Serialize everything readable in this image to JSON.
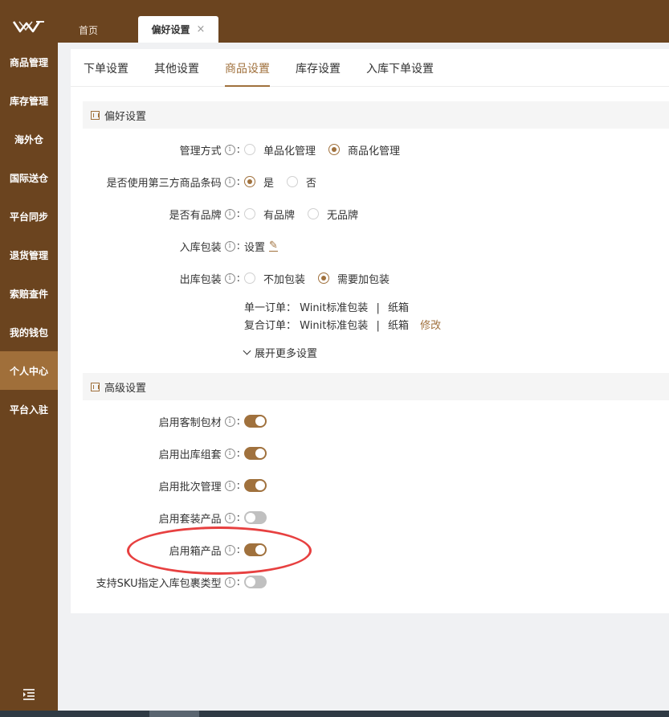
{
  "sidebar": {
    "items": [
      {
        "label": "商品管理"
      },
      {
        "label": "库存管理"
      },
      {
        "label": "海外仓"
      },
      {
        "label": "国际送仓"
      },
      {
        "label": "平台同步"
      },
      {
        "label": "退货管理"
      },
      {
        "label": "索赔查件"
      },
      {
        "label": "我的钱包"
      },
      {
        "label": "个人中心",
        "active": true
      },
      {
        "label": "平台入驻"
      }
    ],
    "bottom_icon": "menu-indent-icon"
  },
  "topbar": {
    "tabs": [
      {
        "label": "首页"
      },
      {
        "label": "偏好设置",
        "close": "×",
        "active": true
      }
    ]
  },
  "subtabs": [
    {
      "label": "下单设置"
    },
    {
      "label": "其他设置"
    },
    {
      "label": "商品设置",
      "active": true
    },
    {
      "label": "库存设置"
    },
    {
      "label": "入库下单设置"
    }
  ],
  "preference": {
    "title": "偏好设置",
    "manage_mode": {
      "label": "管理方式",
      "options": [
        "单品化管理",
        "商品化管理"
      ],
      "selected": 1
    },
    "third_party_barcode": {
      "label": "是否使用第三方商品条码",
      "options": [
        "是",
        "否"
      ],
      "selected": 0
    },
    "has_brand": {
      "label": "是否有品牌",
      "options": [
        "有品牌",
        "无品牌"
      ],
      "selected": -1
    },
    "inbound_packing": {
      "label": "入库包装",
      "value": "设置"
    },
    "outbound_packing": {
      "label": "出库包装",
      "options": [
        "不加包装",
        "需要加包装"
      ],
      "selected": 1
    },
    "packing_lines": [
      {
        "key": "单一订单：",
        "pack": "Winit标准包装",
        "sep": "|",
        "box": "纸箱"
      },
      {
        "key": "复合订单：",
        "pack": "Winit标准包装",
        "sep": "|",
        "box": "纸箱",
        "modify": "修改"
      }
    ],
    "expand_label": "展开更多设置"
  },
  "advanced": {
    "title": "高级设置",
    "toggles": [
      {
        "label": "启用客制包材",
        "on": true
      },
      {
        "label": "启用出库组套",
        "on": true
      },
      {
        "label": "启用批次管理",
        "on": true
      },
      {
        "label": "启用套装产品",
        "on": false
      },
      {
        "label": "启用箱产品",
        "on": true
      },
      {
        "label": "支持SKU指定入库包裹类型",
        "on": false
      }
    ]
  },
  "colors": {
    "brand": "#6b441f",
    "accent": "#a0713d",
    "annotation": "#e74040"
  }
}
